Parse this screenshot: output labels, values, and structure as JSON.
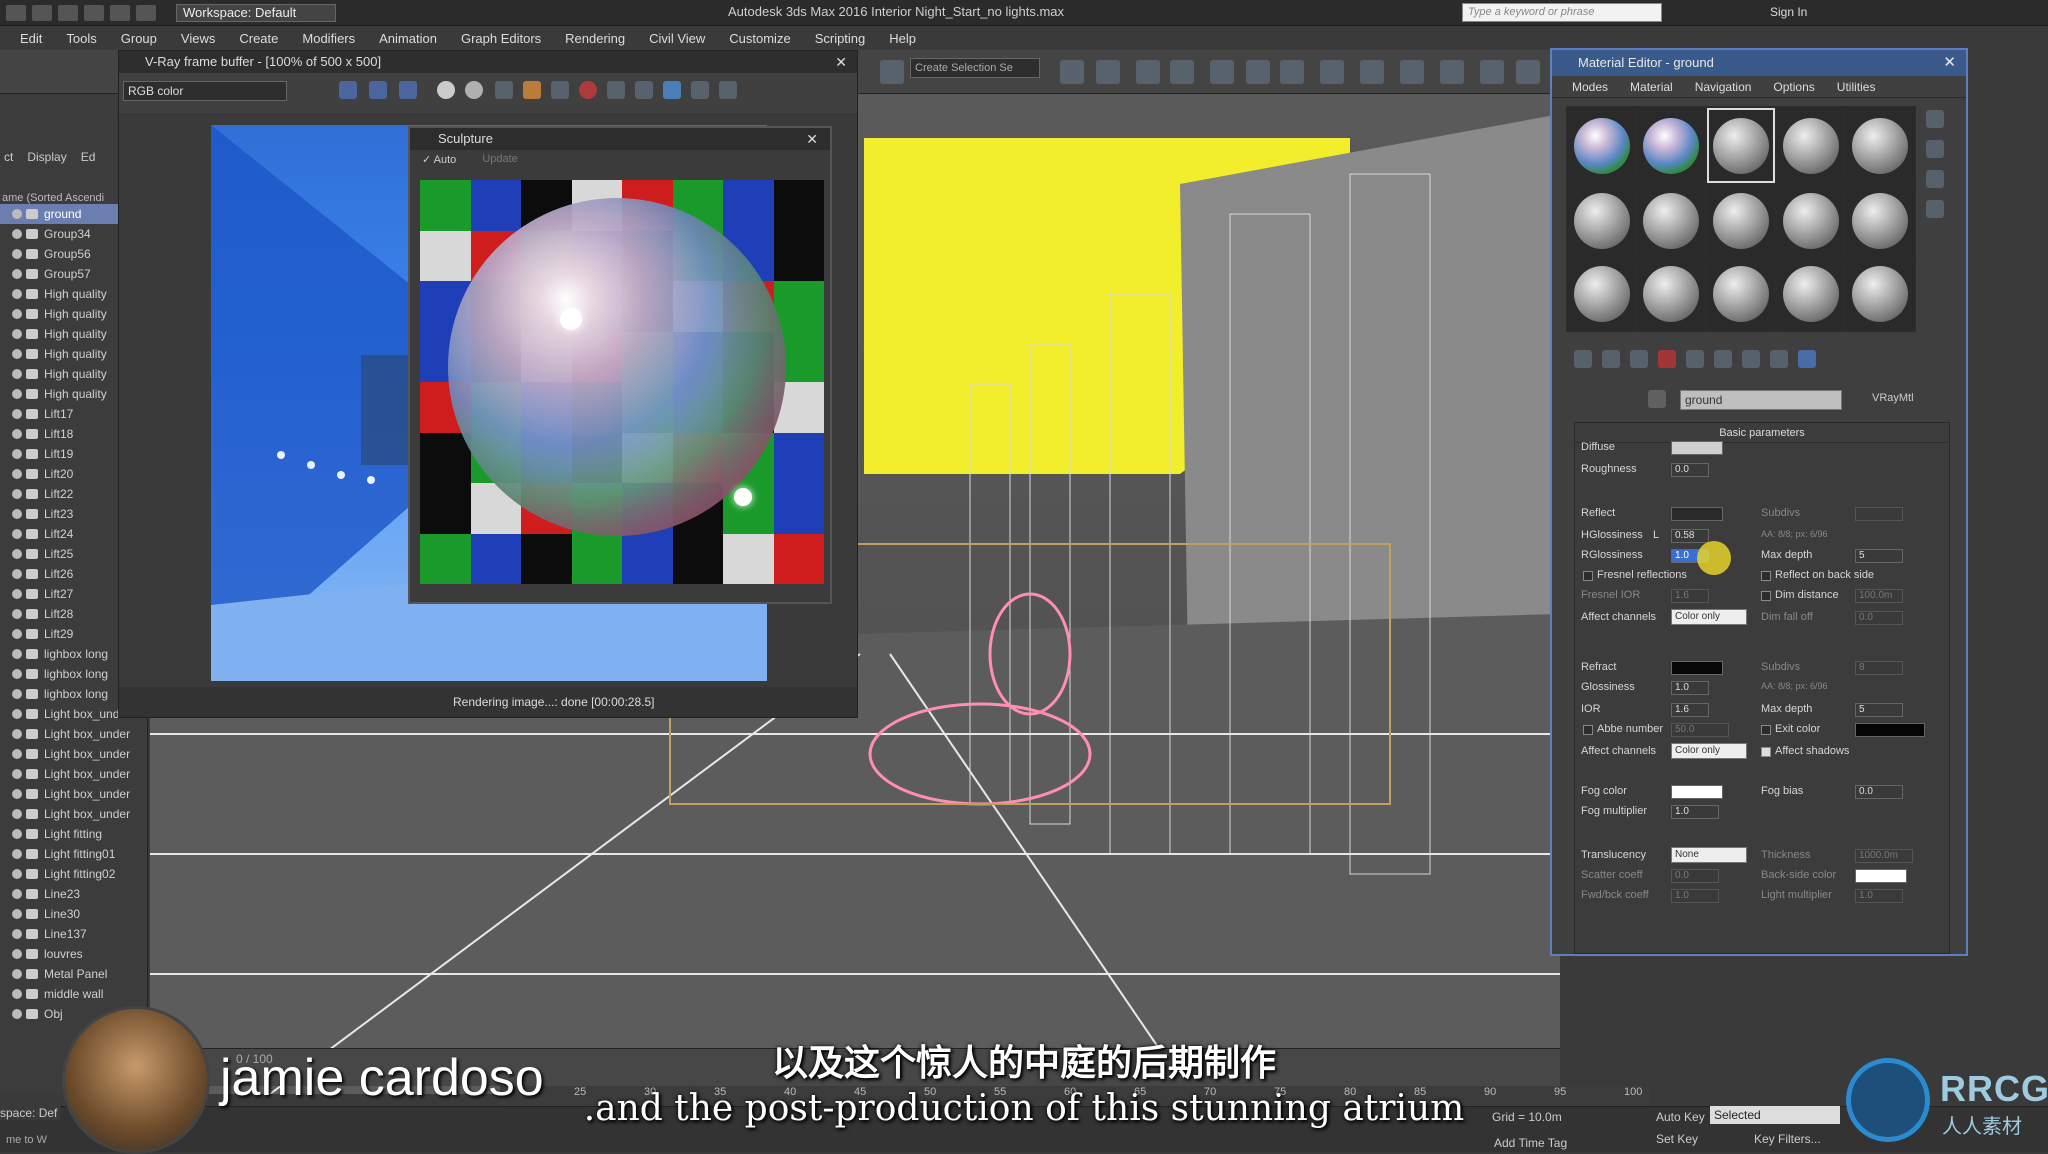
{
  "app": {
    "title": "Autodesk 3ds Max 2016    Interior Night_Start_no lights.max",
    "workspace": "Workspace: Default",
    "search_placeholder": "Type a keyword or phrase",
    "sign_in": "Sign In"
  },
  "menu": [
    "Edit",
    "Tools",
    "Group",
    "Views",
    "Create",
    "Modifiers",
    "Animation",
    "Graph Editors",
    "Rendering",
    "Civil View",
    "Customize",
    "Scripting",
    "Help"
  ],
  "toolbar": {
    "selection_set": "Create Selection Se"
  },
  "left_panel": {
    "tabs": [
      "ct",
      "Display",
      "Ed"
    ],
    "header": "ame (Sorted Ascendi",
    "items": [
      "ground",
      "Group34",
      "Group56",
      "Group57",
      "High quality",
      "High quality",
      "High quality",
      "High quality",
      "High quality",
      "High quality",
      "Lift17",
      "Lift18",
      "Lift19",
      "Lift20",
      "Lift22",
      "Lift23",
      "Lift24",
      "Lift25",
      "Lift26",
      "Lift27",
      "Lift28",
      "Lift29",
      "lighbox long",
      "lighbox long",
      "lighbox long",
      "Light box_under",
      "Light box_under",
      "Light box_under",
      "Light box_under",
      "Light box_under",
      "Light box_under",
      "Light fitting",
      "Light fitting01",
      "Light fitting02",
      "Line23",
      "Line30",
      "Line137",
      "louvres",
      "Metal Panel",
      "middle wall",
      "Obj"
    ],
    "footer": "space: Def",
    "bottom_left": "me to W"
  },
  "vfb": {
    "title": "V-Ray frame buffer - [100% of 500 x 500]",
    "channel": "RGB color",
    "status": "Rendering image...: done [00:00:28.5]"
  },
  "sculpt": {
    "title": "Sculpture",
    "auto_label": "Auto",
    "update_label": "Update",
    "checker_colors": [
      "#1a9a2a",
      "#1f3fb8",
      "#0c0c0c",
      "#d8d8d8",
      "#cf1d1d",
      "#1a9a2a",
      "#1f3fb8",
      "#0c0c0c"
    ]
  },
  "material_editor": {
    "title": "Material Editor - ground",
    "menu": [
      "Modes",
      "Material",
      "Navigation",
      "Options",
      "Utilities"
    ],
    "material_name": "ground",
    "material_type": "VRayMtl",
    "section": "Basic parameters",
    "params": {
      "diffuse": "Diffuse",
      "roughness": "Roughness",
      "roughness_val": "0.0",
      "reflect": "Reflect",
      "subdivs": "Subdivs",
      "hglossiness": "HGlossiness",
      "hglossiness_lock": "L",
      "hglossiness_val": "0.58",
      "aa": "AA: 8/8; px: 6/96",
      "rglossiness": "RGlossiness",
      "rglossiness_val": "1.0",
      "max_depth": "Max depth",
      "max_depth_val": "5",
      "fresnel": "Fresnel reflections",
      "reflect_back": "Reflect on back side",
      "fresnel_ior": "Fresnel IOR",
      "fresnel_ior_val": "1.6",
      "dim_distance": "Dim distance",
      "dim_distance_val": "100.0m",
      "affect_channels": "Affect channels",
      "color_only": "Color only",
      "dim_falloff": "Dim fall off",
      "dim_falloff_val": "0.0",
      "refract": "Refract",
      "refract_subdivs": "Subdivs",
      "refract_subdivs_val": "8",
      "refract_aa": "AA: 8/8; px: 6/96",
      "glossiness": "Glossiness",
      "glossiness_val": "1.0",
      "ior": "IOR",
      "ior_val": "1.6",
      "refract_max_depth": "Max depth",
      "refract_max_depth_val": "5",
      "abbe": "Abbe number",
      "abbe_val": "50.0",
      "exit_color": "Exit color",
      "affect_channels2": "Affect channels",
      "color_only2": "Color only",
      "affect_shadows": "Affect shadows",
      "fog_color": "Fog color",
      "fog_bias": "Fog bias",
      "fog_bias_val": "0.0",
      "fog_mult": "Fog multiplier",
      "fog_mult_val": "1.0",
      "translucency": "Translucency",
      "translucency_val": "None",
      "thickness": "Thickness",
      "thickness_val": "1000.0m",
      "scatter": "Scatter coeff",
      "scatter_val": "0.0",
      "back_side_color": "Back-side color",
      "fwd_bck": "Fwd/bck coeff",
      "fwd_bck_val": "1.0",
      "light_mult": "Light multiplier",
      "light_mult_val": "1.0"
    }
  },
  "timeline": {
    "frame": "0 / 100",
    "ticks": [
      "25",
      "30",
      "35",
      "40",
      "45",
      "50",
      "55",
      "60",
      "65",
      "70",
      "75",
      "80",
      "85",
      "90",
      "95",
      "100"
    ],
    "grid": "Grid = 10.0m",
    "auto_key": "Auto Key",
    "selected": "Selected",
    "set_key": "Set Key",
    "key_filters": "Key Filters...",
    "add_time_tag": "Add Time Tag"
  },
  "overlay": {
    "presenter": "jamie cardoso",
    "subtitle_cn": "以及这个惊人的中庭的后期制作",
    "subtitle_en": ".and the post-production of this stunning atrium",
    "watermark": "RRCG",
    "watermark_sub": "人人素材"
  }
}
